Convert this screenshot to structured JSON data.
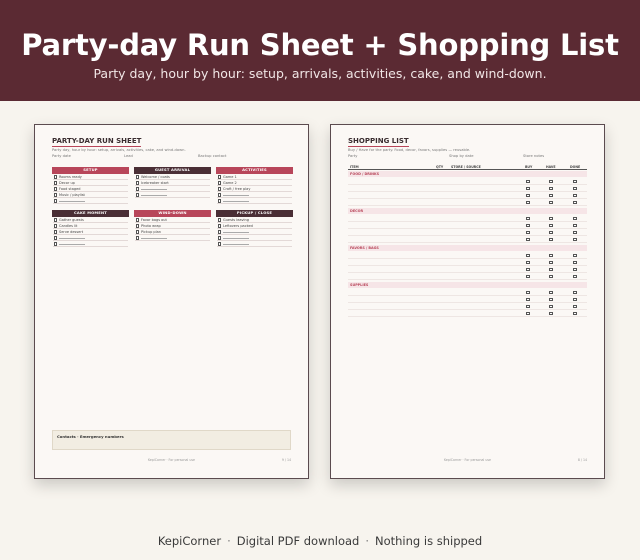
{
  "banner": {
    "title": "Party-day Run Sheet + Shopping List",
    "subtitle": "Party day, hour by hour: setup, arrivals, activities, cake, and wind-down."
  },
  "run_sheet": {
    "title": "PARTY-DAY RUN SHEET",
    "subtitle": "Party day, hour by hour: setup, arrivals, activities, cake, and wind-down.",
    "meta": [
      "Party date",
      "Lead",
      "Backup contact"
    ],
    "boxes": [
      {
        "title": "SETUP",
        "items": [
          "Rooms ready",
          "Decor up",
          "Food staged",
          "Music / playlist",
          ""
        ]
      },
      {
        "title": "GUEST ARRIVAL",
        "items": [
          "Welcome / coats",
          "Icebreaker start",
          "",
          ""
        ]
      },
      {
        "title": "ACTIVITIES",
        "items": [
          "Game 1",
          "Game 2",
          "Craft / free play",
          "",
          ""
        ]
      },
      {
        "title": "CAKE MOMENT",
        "items": [
          "Gather guests",
          "Candles lit",
          "Serve dessert",
          "",
          ""
        ]
      },
      {
        "title": "WIND-DOWN",
        "items": [
          "Favor bags out",
          "Photo wrap",
          "Pickup plan",
          ""
        ]
      },
      {
        "title": "PICKUP / CLOSE",
        "items": [
          "Guests leaving",
          "Leftovers packed",
          "",
          "",
          ""
        ]
      }
    ],
    "contacts_label": "Contacts · Emergency numbers",
    "footer": "KepiCorner · For personal use",
    "page_num": "9 / 14"
  },
  "shopping": {
    "title": "SHOPPING LIST",
    "subtitle": "Buy / Have for the party. Food, decor, favors, supplies — reusable.",
    "meta": [
      "Party",
      "Shop by date",
      "Store notes"
    ],
    "columns": [
      "ITEM",
      "QTY",
      "STORE / SOURCE",
      "BUY",
      "HAVE",
      "DONE"
    ],
    "categories": [
      "FOOD / DRINKS",
      "DECOR",
      "FAVORS / BAGS",
      "SUPPLIES"
    ],
    "footer": "KepiCorner · For personal use",
    "page_num": "8 / 14"
  },
  "footer": {
    "brand": "KepiCorner",
    "download": "Digital PDF download",
    "shipping": "Nothing is shipped"
  }
}
